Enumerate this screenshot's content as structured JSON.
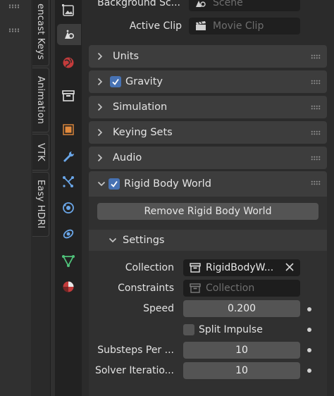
{
  "vertical_tabs": [
    {
      "label": "encast Keys"
    },
    {
      "label": "Animation"
    },
    {
      "label": "VTK"
    },
    {
      "label": "Easy HDRI"
    }
  ],
  "scene": {
    "background_scene_label": "Background Sc...",
    "background_scene_placeholder": "Scene",
    "active_clip_label": "Active Clip",
    "active_clip_placeholder": "Movie Clip"
  },
  "panels": {
    "units": "Units",
    "gravity": "Gravity",
    "simulation": "Simulation",
    "keying_sets": "Keying Sets",
    "audio": "Audio",
    "rigid_body_world": "Rigid Body World"
  },
  "rigid_body": {
    "remove_button": "Remove Rigid Body World",
    "settings_title": "Settings",
    "collection_label": "Collection",
    "collection_value": "RigidBodyW...",
    "constraints_label": "Constraints",
    "constraints_placeholder": "Collection",
    "speed_label": "Speed",
    "speed_value": "0.200",
    "split_impulse_label": "Split Impulse",
    "substeps_label": "Substeps Per ...",
    "substeps_value": "10",
    "solver_label": "Solver Iteratio...",
    "solver_value": "10"
  },
  "colors": {
    "accent": "#4772b3",
    "panel_header": "#3d3d3d",
    "field": "#1f1f1f",
    "button": "#545454"
  },
  "icons": {
    "properties_tabs": [
      "render-output-icon",
      "scene-icon",
      "world-icon",
      "collection-icon",
      "object-icon",
      "modifier-icon",
      "particles-icon",
      "physics-icon",
      "constraints-icon",
      "object-data-icon",
      "material-icon"
    ]
  }
}
